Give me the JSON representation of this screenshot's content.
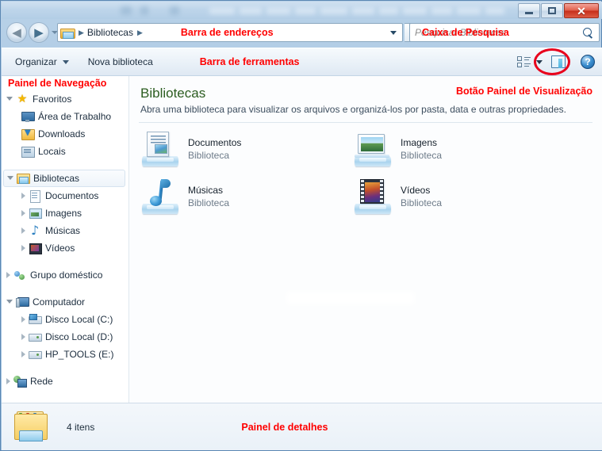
{
  "window": {
    "title_redacted": true,
    "controls": {
      "minimize": "minimize-button",
      "maximize": "maximize-button",
      "close": "✕"
    }
  },
  "address_bar": {
    "back_label": "◀",
    "forward_label": "▶",
    "folder_icon": "library-folder-icon",
    "crumb_separator": "▶",
    "breadcrumbs": [
      "Bibliotecas"
    ],
    "annotation": "Barra de endereços",
    "refresh_label": "↻"
  },
  "search": {
    "placeholder": "Pesquisar Bibliotecas",
    "value": "",
    "annotation": "Caixa de Pesquisa",
    "icon": "search-icon"
  },
  "toolbar": {
    "organize_label": "Organizar",
    "new_library_label": "Nova biblioteca",
    "annotation": "Barra de ferramentas",
    "view_icon": "change-view-icon",
    "preview_pane_icon": "preview-pane-icon",
    "help_label": "?"
  },
  "navigation_pane": {
    "annotation": "Painel de Navegação",
    "groups": [
      {
        "items": [
          {
            "label": "Favoritos",
            "icon": "star-icon",
            "level": 1,
            "expander": "open",
            "selected": false
          },
          {
            "label": "Área de Trabalho",
            "icon": "desktop-icon",
            "level": 2,
            "expander": "none",
            "selected": false
          },
          {
            "label": "Downloads",
            "icon": "downloads-icon",
            "level": 2,
            "expander": "none",
            "selected": false
          },
          {
            "label": "Locais",
            "icon": "recent-places-icon",
            "level": 2,
            "expander": "none",
            "selected": false
          }
        ]
      },
      {
        "items": [
          {
            "label": "Bibliotecas",
            "icon": "libraries-icon",
            "level": 1,
            "expander": "open",
            "selected": true
          },
          {
            "label": "Documentos",
            "icon": "documents-icon",
            "level": 2,
            "expander": "closed",
            "selected": false
          },
          {
            "label": "Imagens",
            "icon": "pictures-icon",
            "level": 2,
            "expander": "closed",
            "selected": false
          },
          {
            "label": "Músicas",
            "icon": "music-icon",
            "level": 2,
            "expander": "closed",
            "selected": false
          },
          {
            "label": "Vídeos",
            "icon": "videos-icon",
            "level": 2,
            "expander": "closed",
            "selected": false
          }
        ]
      },
      {
        "items": [
          {
            "label": "Grupo doméstico",
            "icon": "homegroup-icon",
            "level": 1,
            "expander": "closed",
            "selected": false
          }
        ]
      },
      {
        "items": [
          {
            "label": "Computador",
            "icon": "computer-icon",
            "level": 1,
            "expander": "open",
            "selected": false
          },
          {
            "label": "Disco Local (C:)",
            "icon": "system-drive-icon",
            "level": 2,
            "expander": "closed",
            "selected": false
          },
          {
            "label": "Disco Local (D:)",
            "icon": "drive-icon",
            "level": 2,
            "expander": "closed",
            "selected": false
          },
          {
            "label": "HP_TOOLS (E:)",
            "icon": "drive-icon",
            "level": 2,
            "expander": "closed",
            "selected": false
          }
        ]
      },
      {
        "items": [
          {
            "label": "Rede",
            "icon": "network-icon",
            "level": 1,
            "expander": "closed",
            "selected": false
          }
        ]
      }
    ]
  },
  "content": {
    "title": "Bibliotecas",
    "subtitle": "Abra uma biblioteca para visualizar os arquivos e organizá-los por pasta, data e outras propriedades.",
    "annotation": "Botão Painel de Visualização",
    "items": [
      {
        "name": "Documentos",
        "type": "Biblioteca",
        "icon": "documents-library-icon"
      },
      {
        "name": "Imagens",
        "type": "Biblioteca",
        "icon": "pictures-library-icon"
      },
      {
        "name": "Músicas",
        "type": "Biblioteca",
        "icon": "music-library-icon"
      },
      {
        "name": "Vídeos",
        "type": "Biblioteca",
        "icon": "videos-library-icon"
      }
    ]
  },
  "details_pane": {
    "icon": "libraries-folder-icon",
    "count_label": "4 itens",
    "annotation": "Painel de detalhes"
  },
  "colors": {
    "annotation_red": "#ff0000",
    "title_green": "#2c5d20",
    "frame_blue": "#9dc0df",
    "highlight_circle": "#e8001c"
  }
}
